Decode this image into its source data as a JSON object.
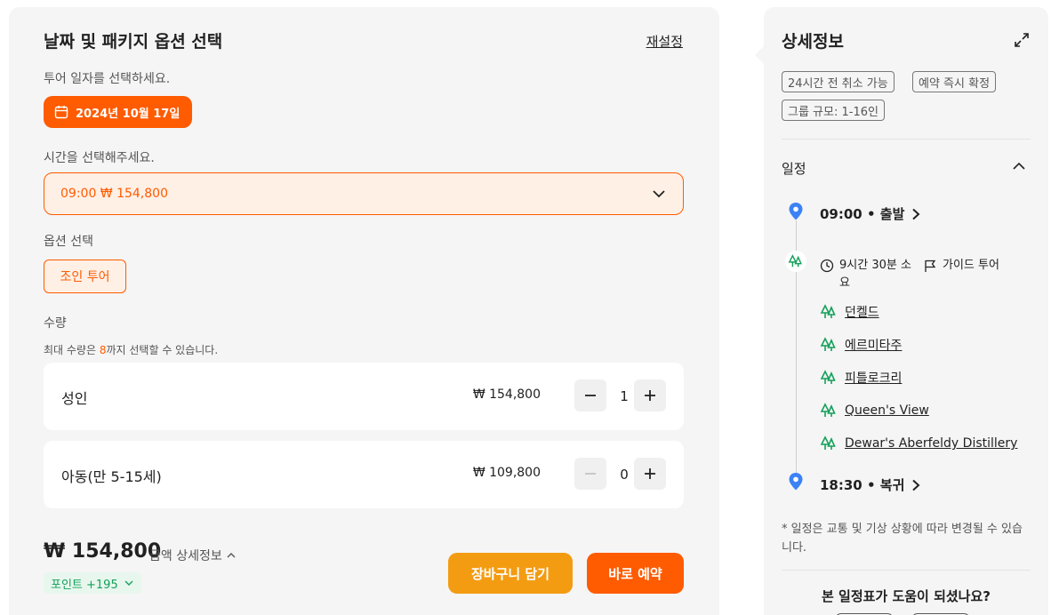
{
  "booking": {
    "title": "날짜 및 패키지 옵션 선택",
    "reset": "재설정",
    "date_label": "투어 일자를 선택하세요.",
    "date_value": "2024년 10월 17일",
    "time_label": "시간을 선택해주세요.",
    "time_value": "09:00 ₩ 154,800",
    "option_label": "옵션 선택",
    "option_value": "조인 투어",
    "qty_label": "수량",
    "max_note_pre": "최대 수량은 ",
    "max_note_num": "8",
    "max_note_post": "까지 선택할 수 있습니다.",
    "rows": [
      {
        "label": "성인",
        "price": "₩ 154,800",
        "count": "1"
      },
      {
        "label": "아동(만 5-15세)",
        "price": "₩ 109,800",
        "count": "0"
      }
    ],
    "total": "₩ 154,800",
    "price_detail": "금액 상세정보",
    "points": "포인트 +195",
    "cart_button": "장바구니 담기",
    "book_button": "바로 예약"
  },
  "details": {
    "title": "상세정보",
    "tags": [
      "24시간 전 취소 가능",
      "예약 즉시 확정",
      "그룹 규모: 1-16인"
    ],
    "itinerary_label": "일정",
    "start": "09:00 • 출발",
    "duration": "9시간 30분 소요",
    "tour_type": "가이드 투어",
    "stops": [
      "던켈드",
      "에르미타주",
      "피틀로크리",
      "Queen's View",
      "Dewar's Aberfeldy Distillery"
    ],
    "end": "18:30 • 복귀",
    "note": "* 일정은 교통 및 기상 상황에 따라 변경될 수 있습니다.",
    "helpful_question": "본 일정표가 도움이 되셨나요?"
  },
  "colors": {
    "accent": "#ff5b00",
    "cart": "#f39c12",
    "points_green": "#14a05a",
    "pin_blue": "#3b82f6",
    "tree_green": "#14a05a"
  },
  "icons": [
    "calendar-icon",
    "chevron-down-icon",
    "minus-icon",
    "plus-icon",
    "expand-icon",
    "chevron-up-icon",
    "map-pin-icon",
    "tree-icon",
    "clock-icon",
    "flag-icon",
    "chevron-right-icon"
  ]
}
